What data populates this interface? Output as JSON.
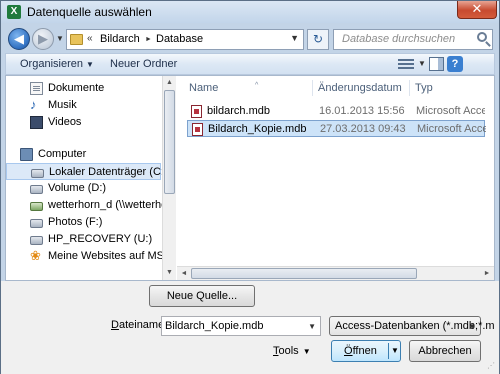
{
  "window": {
    "title": "Datenquelle auswählen",
    "app_icon_glyph": "X",
    "close_glyph": "✕"
  },
  "nav": {
    "back_glyph": "◀",
    "forward_glyph": "▶",
    "history_glyph": "▼",
    "breadcrumb": {
      "overflow": "«",
      "items": [
        "Bildarch",
        "Database"
      ],
      "separator": "►"
    },
    "refresh_glyph": "↻",
    "search_placeholder": "Database durchsuchen"
  },
  "toolbar": {
    "organize_label": "Organisieren",
    "new_folder_label": "Neuer Ordner",
    "dropdown_glyph": "▼"
  },
  "navpane": {
    "items": [
      {
        "label": "Dokumente",
        "icon": "documents-icon"
      },
      {
        "label": "Musik",
        "icon": "music-icon"
      },
      {
        "label": "Videos",
        "icon": "videos-icon"
      },
      {
        "label": "Computer",
        "icon": "computer-icon"
      },
      {
        "label": "Lokaler Datenträger (C:)",
        "icon": "drive-icon"
      },
      {
        "label": "Volume (D:)",
        "icon": "drive-icon"
      },
      {
        "label": "wetterhorn_d (\\\\wetterhor",
        "icon": "network-drive-icon"
      },
      {
        "label": "Photos (F:)",
        "icon": "drive-icon"
      },
      {
        "label": "HP_RECOVERY (U:)",
        "icon": "drive-icon"
      },
      {
        "label": "Meine Websites auf MSN",
        "icon": "msn-icon"
      }
    ],
    "music_glyph": "♪",
    "msn_glyph": "❀"
  },
  "filelist": {
    "columns": [
      "Name",
      "Änderungsdatum",
      "Typ"
    ],
    "sort_caret": "^",
    "rows": [
      {
        "name": "bildarch.mdb",
        "date": "16.01.2013 15:56",
        "type": "Microsoft Access ..."
      },
      {
        "name": "Bildarch_Kopie.mdb",
        "date": "27.03.2013 09:43",
        "type": "Microsoft Access ..."
      }
    ]
  },
  "scroll": {
    "up": "▲",
    "down": "▼",
    "left": "◄",
    "right": "►"
  },
  "bottom": {
    "new_source_label": "Neue Quelle...",
    "filename_label_underlined": "D",
    "filename_label_rest": "ateiname:",
    "filename_value": "Bildarch_Kopie.mdb",
    "filetype_value": "Access-Datenbanken (*.mdb;*.m",
    "tools_label_underlined": "T",
    "tools_label_rest": "ools",
    "open_label_underlined": "Ö",
    "open_label_rest": "ffnen",
    "cancel_label": "Abbrechen",
    "dropdown_glyph": "▼",
    "grip_glyph": "⋰"
  }
}
